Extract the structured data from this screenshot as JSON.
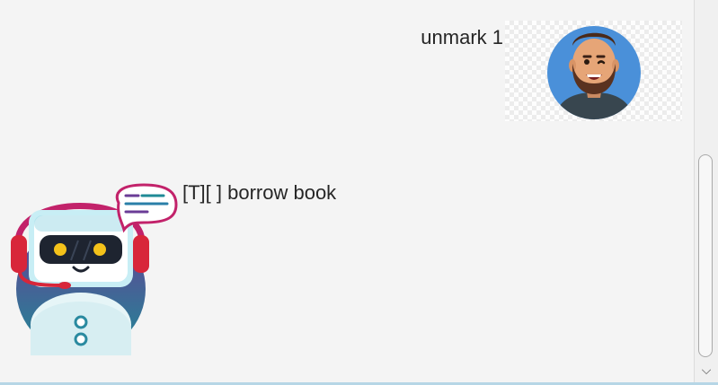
{
  "messages": {
    "user": {
      "text": "unmark 1",
      "avatar_icon": "bearded-man-avatar-icon"
    },
    "bot": {
      "text": "[T][ ] borrow book",
      "avatar_icon": "robot-headset-avatar-icon"
    }
  },
  "scrollbar": {
    "down_arrow": "⌵"
  },
  "colors": {
    "background": "#f4f4f4",
    "user_avatar_circle": "#4a90d9",
    "bot_accent": "#cc2a4a",
    "bot_body": "#0e8b8c"
  }
}
